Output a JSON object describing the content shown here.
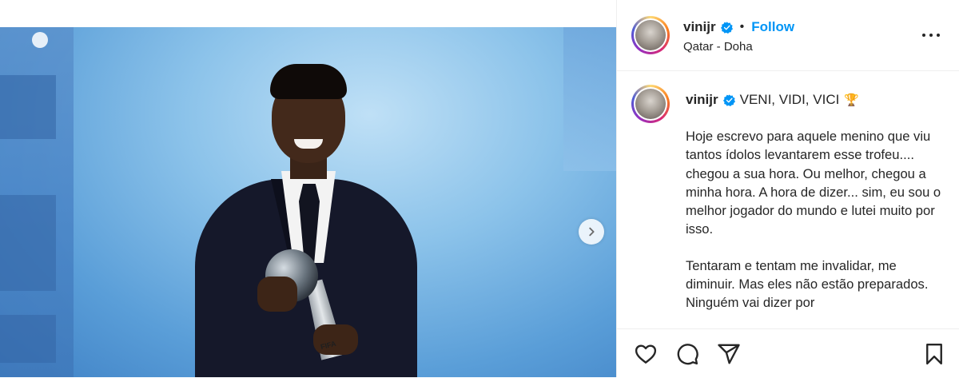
{
  "post": {
    "username": "vinijr",
    "follow_label": "Follow",
    "separator": "•",
    "location": "Qatar - Doha",
    "caption_title": "VENI, VIDI, VICI",
    "caption_emoji": "🏆",
    "caption_paragraphs": [
      "Hoje escrevo para aquele menino que viu tantos ídolos levantarem esse trofeu.... chegou a sua hora. Ou melhor, chegou a minha hora. A hora de dizer... sim, eu sou o melhor jogador do mundo e lutei muito por isso.",
      "Tentaram e tentam me invalidar, me diminuir. Mas eles não estão preparados. Ninguém vai dizer por"
    ]
  },
  "media": {
    "trophy_text": "FIFA"
  },
  "icons": {
    "verified": "verified-badge-icon",
    "more": "more-options-icon",
    "next": "chevron-right-icon",
    "like": "heart-icon",
    "comment": "comment-icon",
    "share": "share-icon",
    "save": "bookmark-icon"
  },
  "colors": {
    "accent": "#0095f6",
    "text": "#262626",
    "divider": "#efefef"
  }
}
